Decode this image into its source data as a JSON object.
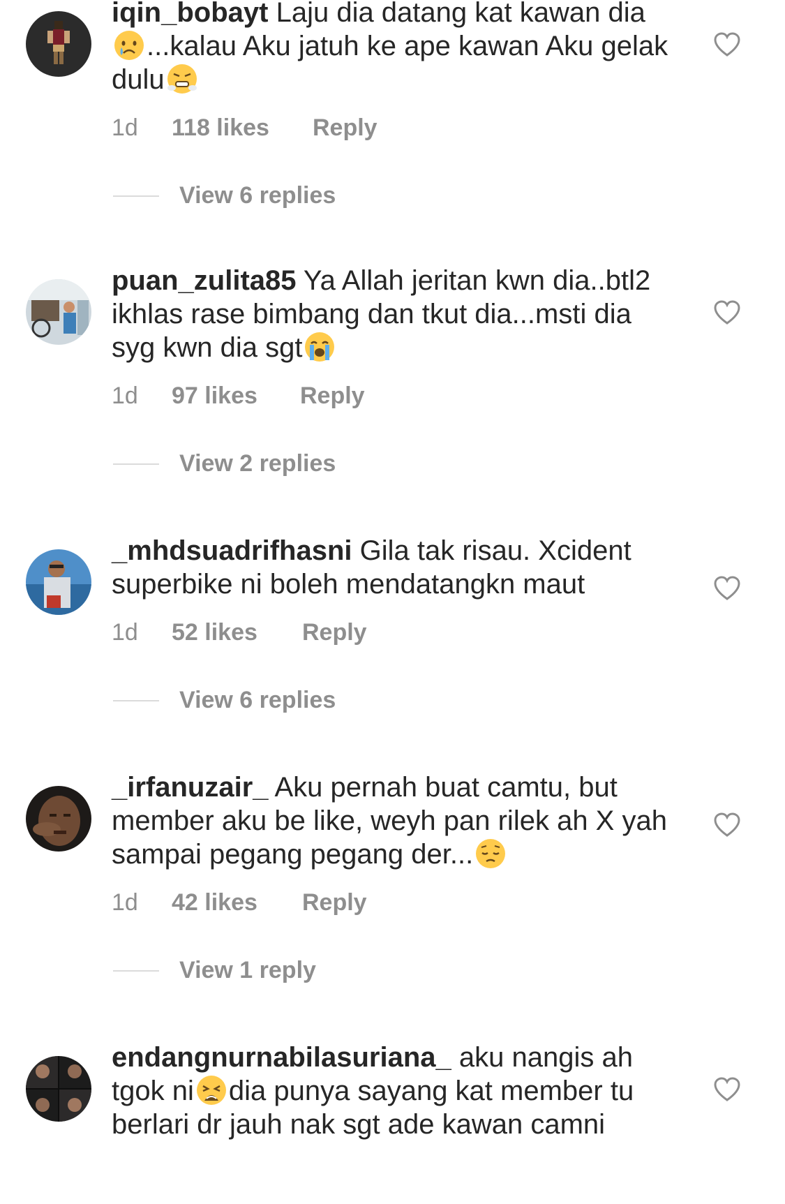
{
  "comments": [
    {
      "username": "iqin_bobayt",
      "segments": [
        "Laju dia datang kat kawan dia",
        "...kalau Aku jatuh ke ape kawan Aku gelak dulu",
        ""
      ],
      "emojis": [
        "crying-face",
        "face-with-steam"
      ],
      "time": "1d",
      "likes": "118 likes",
      "reply": "Reply",
      "view_replies": "View 6 replies"
    },
    {
      "username": "puan_zulita85",
      "segments": [
        "Ya Allah jeritan kwn dia..btl2 ikhlas rase bimbang dan tkut dia...msti dia syg kwn dia sgt",
        ""
      ],
      "emojis": [
        "loudly-crying-face"
      ],
      "time": "1d",
      "likes": "97 likes",
      "reply": "Reply",
      "view_replies": "View 2 replies"
    },
    {
      "username": "_mhdsuadrifhasni",
      "segments": [
        "Gila tak risau. Xcident superbike ni boleh mendatangkn maut"
      ],
      "emojis": [],
      "time": "1d",
      "likes": "52 likes",
      "reply": "Reply",
      "view_replies": "View 6 replies"
    },
    {
      "username": "_irfanuzair_",
      "segments": [
        "Aku pernah buat camtu, but member aku be like, weyh pan rilek ah X yah sampai pegang pegang der...",
        ""
      ],
      "emojis": [
        "pensive-face"
      ],
      "time": "1d",
      "likes": "42 likes",
      "reply": "Reply",
      "view_replies": "View 1 reply"
    },
    {
      "username": "endangnurnabilasuriana_",
      "segments": [
        "aku nangis ah tgok ni",
        "dia punya sayang kat member tu berlari dr jauh nak sgt ade kawan camni"
      ],
      "emojis": [
        "weary-face"
      ],
      "time": "",
      "likes": "",
      "reply": "",
      "view_replies": ""
    }
  ],
  "icons": {
    "like": "heart-outline-icon"
  },
  "colors": {
    "text": "#262626",
    "secondary": "#8e8e8e",
    "divider": "#dbdbdb",
    "emoji_yellow": "#FFCB4C",
    "emoji_tear": "#5DADEC"
  }
}
